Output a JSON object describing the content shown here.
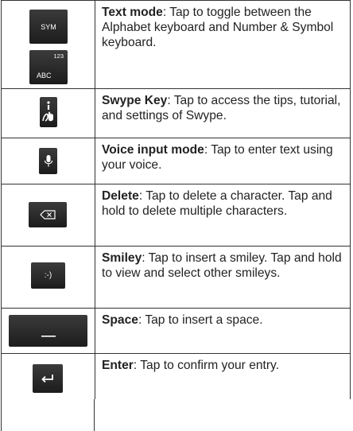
{
  "rows": [
    {
      "title": "Text mode",
      "desc": ": Tap to toggle between the Alphabet keyboard and Number & Symbol keyboard.",
      "key_labels": [
        "SYM",
        "123",
        "ABC"
      ],
      "icons": []
    },
    {
      "title": "Swype Key",
      "desc": ": Tap to access the tips, tutorial, and settings of Swype.",
      "key_labels": [],
      "icons": [
        "swype-info-icon"
      ]
    },
    {
      "title": "Voice input mode",
      "desc": ": Tap to enter text using your voice.",
      "key_labels": [],
      "icons": [
        "microphone-icon"
      ]
    },
    {
      "title": "Delete",
      "desc": ": Tap to delete a character. Tap and hold to delete multiple characters.",
      "key_labels": [],
      "icons": [
        "backspace-icon"
      ]
    },
    {
      "title": "Smiley",
      "desc": ": Tap to insert a smiley. Tap and hold to view and select other smileys.",
      "key_labels": [
        ":-)"
      ],
      "icons": []
    },
    {
      "title": "Space",
      "desc": ": Tap to insert a space.",
      "key_labels": [],
      "icons": [
        "spacebar-icon"
      ]
    },
    {
      "title": "Enter",
      "desc": ": Tap to confirm your entry.",
      "key_labels": [],
      "icons": [
        "enter-arrow-icon"
      ]
    }
  ]
}
